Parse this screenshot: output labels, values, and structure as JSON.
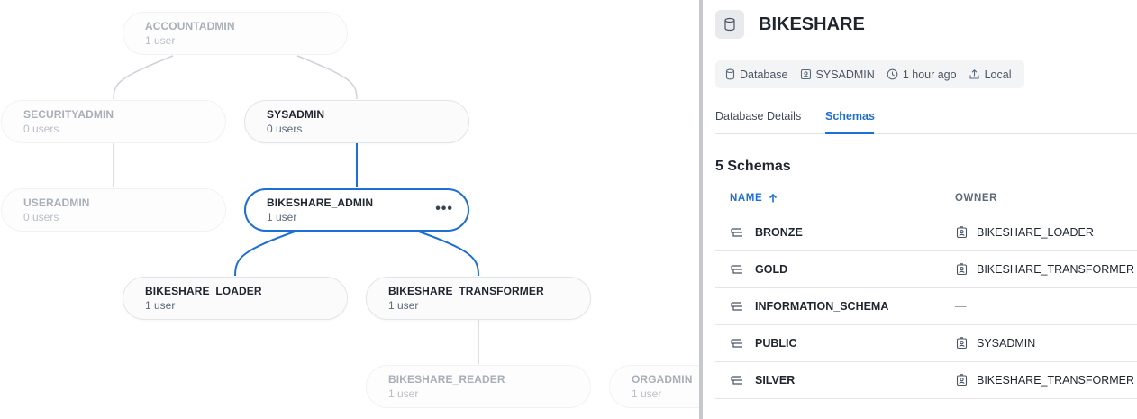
{
  "graph": {
    "nodes": {
      "accountadmin": {
        "title": "ACCOUNTADMIN",
        "sub": "1 user"
      },
      "securityadmin": {
        "title": "SECURITYADMIN",
        "sub": "0 users"
      },
      "sysadmin": {
        "title": "SYSADMIN",
        "sub": "0 users"
      },
      "useradmin": {
        "title": "USERADMIN",
        "sub": "0 users"
      },
      "bikeshare_admin": {
        "title": "BIKESHARE_ADMIN",
        "sub": "1 user",
        "more": "•••"
      },
      "bikeshare_loader": {
        "title": "BIKESHARE_LOADER",
        "sub": "1 user"
      },
      "bikeshare_transformer": {
        "title": "BIKESHARE_TRANSFORMER",
        "sub": "1 user"
      },
      "bikeshare_reader": {
        "title": "BIKESHARE_READER",
        "sub": "1 user"
      },
      "orgadmin": {
        "title": "ORGADMIN",
        "sub": "1 user"
      }
    },
    "colors": {
      "highlight_edge": "#1d6ed6",
      "normal_edge": "#cfd2dc"
    }
  },
  "panel": {
    "title": "BIKESHARE",
    "meta": {
      "type": "Database",
      "owner": "SYSADMIN",
      "created": "1 hour ago",
      "source": "Local"
    },
    "tabs": [
      {
        "label": "Database Details",
        "active": false
      },
      {
        "label": "Schemas",
        "active": true
      }
    ],
    "schemas_count": "5 Schemas",
    "table": {
      "headers": {
        "name": "NAME",
        "owner": "OWNER",
        "sort_icon": "arrow-up-icon"
      },
      "rows": [
        {
          "name": "BRONZE",
          "owner": "BIKESHARE_LOADER"
        },
        {
          "name": "GOLD",
          "owner": "BIKESHARE_TRANSFORMER"
        },
        {
          "name": "INFORMATION_SCHEMA",
          "owner": "—"
        },
        {
          "name": "PUBLIC",
          "owner": "SYSADMIN"
        },
        {
          "name": "SILVER",
          "owner": "BIKESHARE_TRANSFORMER"
        }
      ]
    }
  }
}
